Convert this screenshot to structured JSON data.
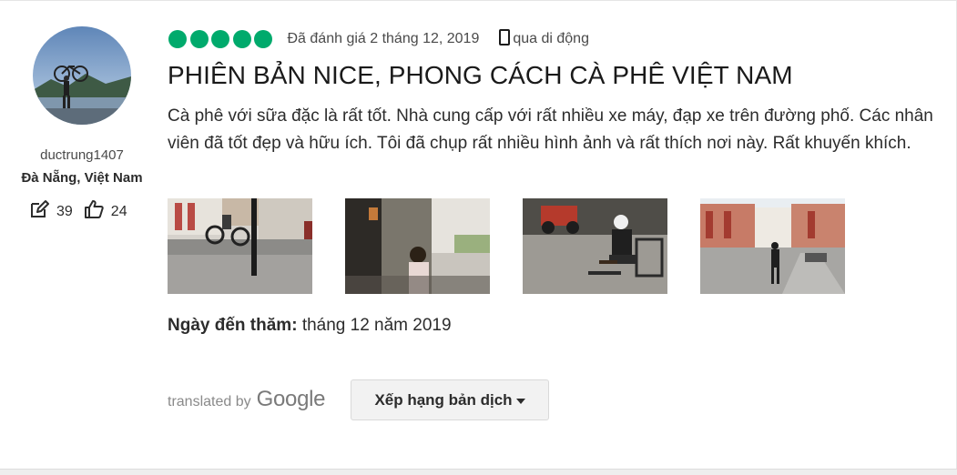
{
  "reviewer": {
    "username": "ductrung1407",
    "location": "Đà Nẵng, Việt Nam",
    "contributions": "39",
    "helpful_votes": "24",
    "icons": {
      "contributions": "edit-icon",
      "helpful": "thumbs-up-icon"
    }
  },
  "review": {
    "rating": 5,
    "rating_max": 5,
    "bubble_color": "#00aa6c",
    "date": "Đã đánh giá 2 tháng 12, 2019",
    "device": "qua di động",
    "device_icon": "mobile-phone-icon",
    "title": "PHIÊN BẢN NICE, PHONG CÁCH CÀ PHÊ VIỆT NAM",
    "body": "Cà phê với sữa đặc là rất tốt. Nhà cung cấp với rất nhiều xe máy, đạp xe trên đường phố. Các nhân viên đã tốt đẹp và hữu ích. Tôi đã chụp rất nhiều hình ảnh và rất thích nơi này. Rất khuyến khích.",
    "photos_count": 4,
    "visit_label": "Ngày đến thăm:",
    "visit_value": "tháng 12 năm 2019"
  },
  "translation": {
    "translated_by": "translated by",
    "google": "Google",
    "rate_button": "Xếp hạng bản dịch"
  }
}
